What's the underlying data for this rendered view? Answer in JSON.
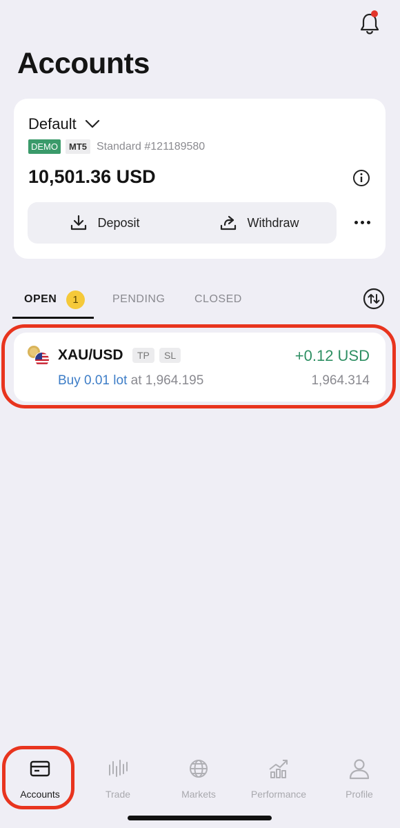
{
  "header": {
    "title": "Accounts",
    "notification_icon": "bell-icon",
    "has_unread": true
  },
  "account": {
    "name": "Default",
    "env_badge": "DEMO",
    "platform_badge": "MT5",
    "type": "Standard #121189580",
    "balance": "10,501.36 USD",
    "deposit_label": "Deposit",
    "withdraw_label": "Withdraw"
  },
  "tabs": {
    "open": {
      "label": "OPEN",
      "count": "1"
    },
    "pending": {
      "label": "PENDING"
    },
    "closed": {
      "label": "CLOSED"
    }
  },
  "positions": [
    {
      "symbol": "XAU/USD",
      "tp_label": "TP",
      "sl_label": "SL",
      "profit": "+0.12 USD",
      "direction_lot": "Buy 0.01 lot",
      "at_label": "at",
      "open_price": "1,964.195",
      "current_price": "1,964.314"
    }
  ],
  "nav": {
    "items": [
      {
        "label": "Accounts",
        "icon": "wallet-icon",
        "active": true
      },
      {
        "label": "Trade",
        "icon": "candles-icon",
        "active": false
      },
      {
        "label": "Markets",
        "icon": "globe-icon",
        "active": false
      },
      {
        "label": "Performance",
        "icon": "chart-icon",
        "active": false
      },
      {
        "label": "Profile",
        "icon": "user-icon",
        "active": false
      }
    ]
  },
  "colors": {
    "profit": "#2e8f63",
    "buy": "#3d7dc7",
    "demo_badge": "#3a9a6a",
    "count_badge": "#f5c93a",
    "highlight": "#e8341e"
  }
}
